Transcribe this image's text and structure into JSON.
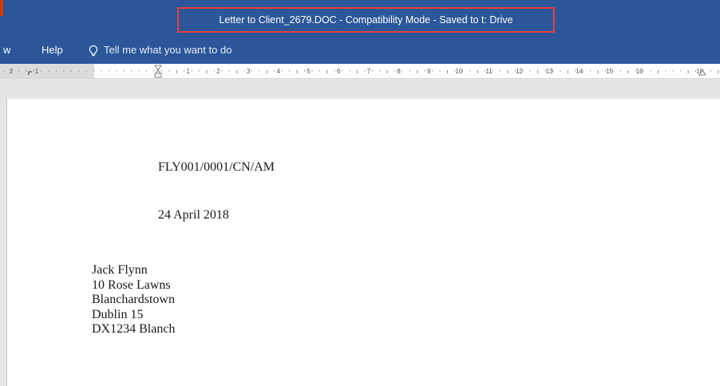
{
  "window": {
    "title": "Letter to Client_2679.DOC  -  Compatibility Mode  -  Saved to t: Drive"
  },
  "ribbon": {
    "tabs": [
      {
        "label": "w"
      },
      {
        "label": "Help"
      }
    ],
    "tell_me": {
      "icon": "lightbulb-icon",
      "placeholder": "Tell me what you want to do"
    }
  },
  "ruler": {
    "left_labels": [
      "2",
      "1"
    ],
    "labels": [
      "1",
      "2",
      "3",
      "4",
      "5",
      "6",
      "7",
      "8",
      "9",
      "10",
      "11",
      "12",
      "13",
      "14",
      "15",
      "16",
      "18"
    ]
  },
  "document": {
    "reference": "FLY001/0001/CN/AM",
    "date": "24 April 2018",
    "address": [
      "Jack Flynn",
      "10 Rose Lawns",
      "Blanchardstown",
      "Dublin 15",
      "DX1234 Blanch"
    ]
  },
  "colors": {
    "ribbon_blue": "#2b579a",
    "highlight_red": "#e8403a",
    "page_white": "#ffffff"
  }
}
